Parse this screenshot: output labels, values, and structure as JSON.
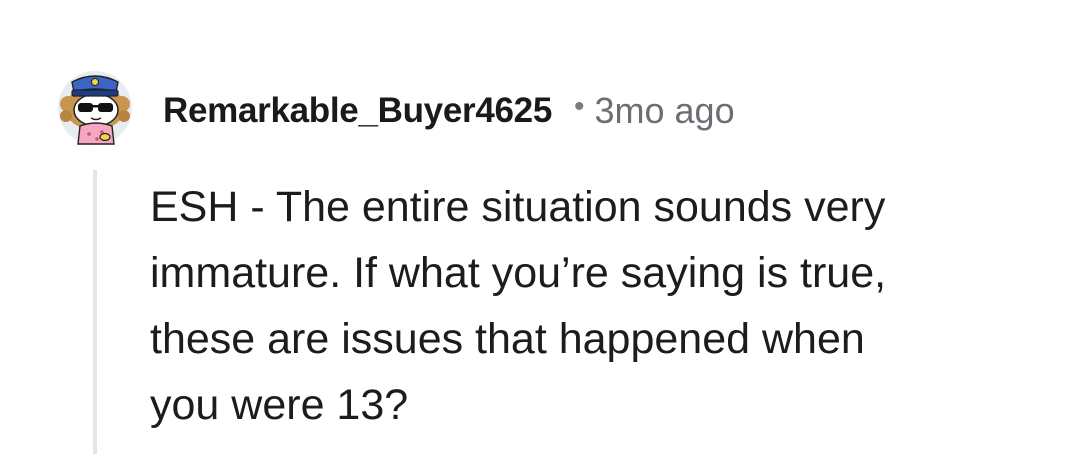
{
  "comment": {
    "author": "Remarkable_Buyer4625",
    "separator": "•",
    "timestamp": "3mo ago",
    "avatar_icon": "snoo-avatar-sunglasses-captain-hat",
    "body_lines": [
      "ESH - The entire situation sounds very",
      "immature. If what you’re saying is true,",
      "these are issues that happened when",
      "you were 13?"
    ]
  }
}
